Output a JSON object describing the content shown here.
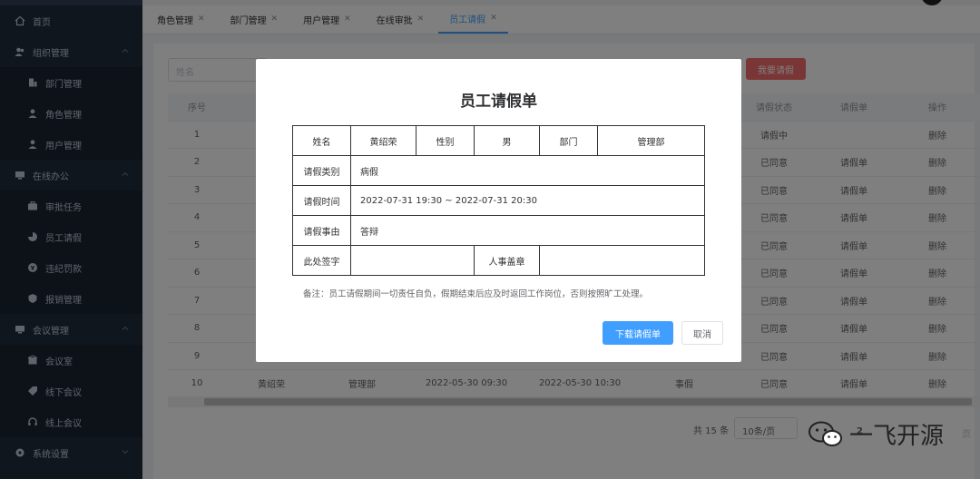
{
  "sidebar": {
    "home": "首页",
    "org_group": "组织管理",
    "org_items": [
      "部门管理",
      "角色管理",
      "用户管理"
    ],
    "office_group": "在线办公",
    "office_items": [
      "审批任务",
      "员工请假",
      "违纪罚款",
      "报销管理"
    ],
    "meeting_group": "会议管理",
    "meeting_items": [
      "会议室",
      "线下会议",
      "线上会议"
    ],
    "system_group": "系统设置"
  },
  "tabs": [
    {
      "label": "角色管理"
    },
    {
      "label": "部门管理"
    },
    {
      "label": "用户管理"
    },
    {
      "label": "在线审批"
    },
    {
      "label": "员工请假",
      "active": true
    }
  ],
  "toolbar": {
    "search_placeholder": "姓名",
    "apply_button": "我要请假"
  },
  "table": {
    "headers": [
      "序号",
      "",
      "",
      "",
      "",
      "",
      "请假状态",
      "请假单",
      "操作"
    ],
    "rows": [
      {
        "no": "1",
        "name": "",
        "dept": "",
        "start": "",
        "end": "",
        "type": "",
        "status": "请假中",
        "status_kind": "wait",
        "slip": "",
        "action": "删除",
        "action_enabled": true
      },
      {
        "no": "2",
        "name": "",
        "dept": "",
        "start": "",
        "end": "",
        "type": "",
        "status": "已同意",
        "status_kind": "ok",
        "slip": "请假单",
        "action": "删除",
        "action_enabled": false
      },
      {
        "no": "3",
        "name": "",
        "dept": "",
        "start": "",
        "end": "",
        "type": "",
        "status": "已同意",
        "status_kind": "ok",
        "slip": "请假单",
        "action": "删除",
        "action_enabled": false
      },
      {
        "no": "4",
        "name": "",
        "dept": "",
        "start": "",
        "end": "",
        "type": "",
        "status": "已同意",
        "status_kind": "ok",
        "slip": "请假单",
        "action": "删除",
        "action_enabled": false
      },
      {
        "no": "5",
        "name": "",
        "dept": "",
        "start": "",
        "end": "",
        "type": "",
        "status": "已同意",
        "status_kind": "ok",
        "slip": "请假单",
        "action": "删除",
        "action_enabled": false
      },
      {
        "no": "6",
        "name": "",
        "dept": "",
        "start": "",
        "end": "",
        "type": "",
        "status": "已同意",
        "status_kind": "ok",
        "slip": "请假单",
        "action": "删除",
        "action_enabled": false
      },
      {
        "no": "7",
        "name": "",
        "dept": "",
        "start": "",
        "end": "",
        "type": "",
        "status": "已同意",
        "status_kind": "ok",
        "slip": "请假单",
        "action": "删除",
        "action_enabled": false
      },
      {
        "no": "8",
        "name": "",
        "dept": "",
        "start": "",
        "end": "",
        "type": "",
        "status": "已同意",
        "status_kind": "ok",
        "slip": "请假单",
        "action": "删除",
        "action_enabled": false
      },
      {
        "no": "9",
        "name": "",
        "dept": "",
        "start": "",
        "end": "",
        "type": "",
        "status": "已同意",
        "status_kind": "ok",
        "slip": "请假单",
        "action": "删除",
        "action_enabled": false
      },
      {
        "no": "10",
        "name": "黄绍荣",
        "dept": "管理部",
        "start": "2022-05-30 09:30",
        "end": "2022-05-30 10:30",
        "type": "事假",
        "status": "已同意",
        "status_kind": "ok",
        "slip": "请假单",
        "action": "删除",
        "action_enabled": false
      }
    ]
  },
  "pagination": {
    "total": "共 15 条",
    "page_size": "10条/页",
    "current_page": "2",
    "goto_suffix": "页"
  },
  "watermark": {
    "text": "一飞开源"
  },
  "modal": {
    "title": "员工请假单",
    "labels": {
      "name": "姓名",
      "gender": "性别",
      "dept": "部门",
      "type": "请假类别",
      "time": "请假时间",
      "reason": "请假事由",
      "sign": "此处签字",
      "hr_seal": "人事盖章"
    },
    "values": {
      "name": "黄绍荣",
      "gender": "男",
      "dept": "管理部",
      "type": "病假",
      "time": "2022-07-31 19:30 ~ 2022-07-31 20:30",
      "reason": "答辩"
    },
    "note": "备注：员工请假期间一切责任自负，假期结束后应及时返回工作岗位，否则按照旷工处理。",
    "download_button": "下载请假单",
    "cancel_button": "取消"
  },
  "colors": {
    "sidebar_bg": "#1f2d3d",
    "primary": "#409eff",
    "danger": "#f56c6c",
    "success": "#67c23a",
    "warning": "#e6a23c"
  }
}
